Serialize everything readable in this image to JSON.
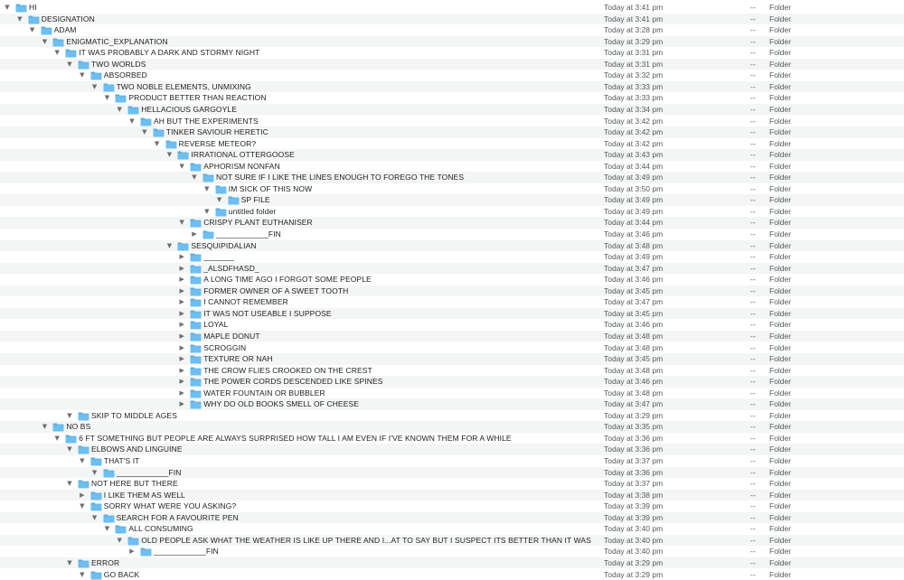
{
  "colors": {
    "folder_body": "#6cbff0",
    "folder_tab": "#5aaee2",
    "row_alt": "#f4f5f5"
  },
  "rows": [
    {
      "depth": 0,
      "disclosure": "open",
      "name": "HI",
      "date": "Today at 3:41 pm",
      "size": "--",
      "kind": "Folder"
    },
    {
      "depth": 1,
      "disclosure": "open",
      "name": "DESIGNATION",
      "date": "Today at 3:41 pm",
      "size": "--",
      "kind": "Folder"
    },
    {
      "depth": 2,
      "disclosure": "open",
      "name": "ADAM",
      "date": "Today at 3:28 pm",
      "size": "--",
      "kind": "Folder"
    },
    {
      "depth": 3,
      "disclosure": "open",
      "name": "ENIGMATIC_EXPLANATION",
      "date": "Today at 3:29 pm",
      "size": "--",
      "kind": "Folder"
    },
    {
      "depth": 4,
      "disclosure": "open",
      "name": "IT WAS PROBABLY A DARK AND STORMY NIGHT",
      "date": "Today at 3:31 pm",
      "size": "--",
      "kind": "Folder"
    },
    {
      "depth": 5,
      "disclosure": "open",
      "name": "TWO WORLDS",
      "date": "Today at 3:31 pm",
      "size": "--",
      "kind": "Folder"
    },
    {
      "depth": 6,
      "disclosure": "open",
      "name": "ABSORBED",
      "date": "Today at 3:32 pm",
      "size": "--",
      "kind": "Folder"
    },
    {
      "depth": 7,
      "disclosure": "open",
      "name": "TWO NOBLE ELEMENTS, UNMIXING",
      "date": "Today at 3:33 pm",
      "size": "--",
      "kind": "Folder"
    },
    {
      "depth": 8,
      "disclosure": "open",
      "name": "PRODUCT BETTER THAN REACTION",
      "date": "Today at 3:33 pm",
      "size": "--",
      "kind": "Folder"
    },
    {
      "depth": 9,
      "disclosure": "open",
      "name": "HELLACIOUS GARGOYLE",
      "date": "Today at 3:34 pm",
      "size": "--",
      "kind": "Folder"
    },
    {
      "depth": 10,
      "disclosure": "open",
      "name": "AH BUT THE EXPERIMENTS",
      "date": "Today at 3:42 pm",
      "size": "--",
      "kind": "Folder"
    },
    {
      "depth": 11,
      "disclosure": "open",
      "name": "TINKER SAVIOUR HERETIC",
      "date": "Today at 3:42 pm",
      "size": "--",
      "kind": "Folder"
    },
    {
      "depth": 12,
      "disclosure": "open",
      "name": "REVERSE METEOR?",
      "date": "Today at 3:42 pm",
      "size": "--",
      "kind": "Folder"
    },
    {
      "depth": 13,
      "disclosure": "open",
      "name": "IRRATIONAL OTTERGOOSE",
      "date": "Today at 3:43 pm",
      "size": "--",
      "kind": "Folder"
    },
    {
      "depth": 14,
      "disclosure": "open",
      "name": "APHORISM NONFAN",
      "date": "Today at 3:44 pm",
      "size": "--",
      "kind": "Folder"
    },
    {
      "depth": 15,
      "disclosure": "open",
      "name": "NOT SURE IF I LIKE THE LINES ENOUGH TO FOREGO THE TONES",
      "date": "Today at 3:49 pm",
      "size": "--",
      "kind": "Folder"
    },
    {
      "depth": 16,
      "disclosure": "open",
      "name": "IM SICK OF THIS NOW",
      "date": "Today at 3:50 pm",
      "size": "--",
      "kind": "Folder"
    },
    {
      "depth": 17,
      "disclosure": "open",
      "name": "SP FILE",
      "date": "Today at 3:49 pm",
      "size": "--",
      "kind": "Folder"
    },
    {
      "depth": 16,
      "disclosure": "open",
      "name": "untitled folder",
      "date": "Today at 3:49 pm",
      "size": "--",
      "kind": "Folder"
    },
    {
      "depth": 14,
      "disclosure": "open",
      "name": "CRISPY PLANT EUTHANISER",
      "date": "Today at 3:44 pm",
      "size": "--",
      "kind": "Folder"
    },
    {
      "depth": 15,
      "disclosure": "closed",
      "name": "____________FIN",
      "date": "Today at 3:46 pm",
      "size": "--",
      "kind": "Folder"
    },
    {
      "depth": 13,
      "disclosure": "open",
      "name": "SESQUIPIDALIAN",
      "date": "Today at 3:48 pm",
      "size": "--",
      "kind": "Folder"
    },
    {
      "depth": 14,
      "disclosure": "closed",
      "name": "_______",
      "date": "Today at 3:49 pm",
      "size": "--",
      "kind": "Folder"
    },
    {
      "depth": 14,
      "disclosure": "closed",
      "name": "_ALSDFHASD_",
      "date": "Today at 3:47 pm",
      "size": "--",
      "kind": "Folder"
    },
    {
      "depth": 14,
      "disclosure": "closed",
      "name": "A LONG TIME AGO I FORGOT SOME PEOPLE",
      "date": "Today at 3:46 pm",
      "size": "--",
      "kind": "Folder"
    },
    {
      "depth": 14,
      "disclosure": "closed",
      "name": "FORMER OWNER OF A SWEET TOOTH",
      "date": "Today at 3:45 pm",
      "size": "--",
      "kind": "Folder"
    },
    {
      "depth": 14,
      "disclosure": "closed",
      "name": "I CANNOT REMEMBER",
      "date": "Today at 3:47 pm",
      "size": "--",
      "kind": "Folder"
    },
    {
      "depth": 14,
      "disclosure": "closed",
      "name": "IT WAS NOT USEABLE I SUPPOSE",
      "date": "Today at 3:45 pm",
      "size": "--",
      "kind": "Folder"
    },
    {
      "depth": 14,
      "disclosure": "closed",
      "name": "LOYAL",
      "date": "Today at 3:46 pm",
      "size": "--",
      "kind": "Folder"
    },
    {
      "depth": 14,
      "disclosure": "closed",
      "name": "MAPLE DONUT",
      "date": "Today at 3:48 pm",
      "size": "--",
      "kind": "Folder"
    },
    {
      "depth": 14,
      "disclosure": "closed",
      "name": "SCROGGIN",
      "date": "Today at 3:48 pm",
      "size": "--",
      "kind": "Folder"
    },
    {
      "depth": 14,
      "disclosure": "closed",
      "name": "TEXTURE OR NAH",
      "date": "Today at 3:45 pm",
      "size": "--",
      "kind": "Folder"
    },
    {
      "depth": 14,
      "disclosure": "closed",
      "name": "THE CROW FLIES CROOKED ON THE CREST",
      "date": "Today at 3:48 pm",
      "size": "--",
      "kind": "Folder"
    },
    {
      "depth": 14,
      "disclosure": "closed",
      "name": "THE POWER CORDS DESCENDED LIKE SPINES",
      "date": "Today at 3:46 pm",
      "size": "--",
      "kind": "Folder"
    },
    {
      "depth": 14,
      "disclosure": "closed",
      "name": "WATER FOUNTAIN OR BUBBLER",
      "date": "Today at 3:48 pm",
      "size": "--",
      "kind": "Folder"
    },
    {
      "depth": 14,
      "disclosure": "closed",
      "name": "WHY DO OLD BOOKS SMELL OF CHEESE",
      "date": "Today at 3:47 pm",
      "size": "--",
      "kind": "Folder"
    },
    {
      "depth": 5,
      "disclosure": "open",
      "name": "SKIP TO MIDDLE AGES",
      "date": "Today at 3:29 pm",
      "size": "--",
      "kind": "Folder"
    },
    {
      "depth": 3,
      "disclosure": "open",
      "name": "NO BS",
      "date": "Today at 3:35 pm",
      "size": "--",
      "kind": "Folder"
    },
    {
      "depth": 4,
      "disclosure": "open",
      "name": "6 FT SOMETHING BUT PEOPLE ARE ALWAYS SURPRISED HOW TALL I AM EVEN IF I'VE KNOWN THEM FOR A WHILE",
      "date": "Today at 3:36 pm",
      "size": "--",
      "kind": "Folder"
    },
    {
      "depth": 5,
      "disclosure": "open",
      "name": "ELBOWS AND LINGUINE",
      "date": "Today at 3:36 pm",
      "size": "--",
      "kind": "Folder"
    },
    {
      "depth": 6,
      "disclosure": "open",
      "name": "THAT'S IT",
      "date": "Today at 3:37 pm",
      "size": "--",
      "kind": "Folder"
    },
    {
      "depth": 7,
      "disclosure": "open",
      "name": "____________FIN",
      "date": "Today at 3:36 pm",
      "size": "--",
      "kind": "Folder"
    },
    {
      "depth": 5,
      "disclosure": "open",
      "name": "NOT HERE BUT THERE",
      "date": "Today at 3:37 pm",
      "size": "--",
      "kind": "Folder"
    },
    {
      "depth": 6,
      "disclosure": "closed",
      "name": "I LIKE THEM AS WELL",
      "date": "Today at 3:38 pm",
      "size": "--",
      "kind": "Folder"
    },
    {
      "depth": 6,
      "disclosure": "open",
      "name": "SORRY WHAT WERE YOU ASKING?",
      "date": "Today at 3:39 pm",
      "size": "--",
      "kind": "Folder"
    },
    {
      "depth": 7,
      "disclosure": "open",
      "name": "SEARCH FOR A FAVOURITE PEN",
      "date": "Today at 3:39 pm",
      "size": "--",
      "kind": "Folder"
    },
    {
      "depth": 8,
      "disclosure": "open",
      "name": "ALL CONSUMING",
      "date": "Today at 3:40 pm",
      "size": "--",
      "kind": "Folder"
    },
    {
      "depth": 9,
      "disclosure": "open",
      "name": "OLD PEOPLE ASK WHAT THE WEATHER IS LIKE UP THERE AND I...AT TO SAY BUT I SUSPECT ITS BETTER THAN IT WAS IN THE WAR",
      "date": "Today at 3:40 pm",
      "size": "--",
      "kind": "Folder"
    },
    {
      "depth": 10,
      "disclosure": "closed",
      "name": "____________FIN",
      "date": "Today at 3:40 pm",
      "size": "--",
      "kind": "Folder"
    },
    {
      "depth": 5,
      "disclosure": "open",
      "name": "ERROR",
      "date": "Today at 3:29 pm",
      "size": "--",
      "kind": "Folder"
    },
    {
      "depth": 6,
      "disclosure": "open",
      "name": "GO BACK",
      "date": "Today at 3:29 pm",
      "size": "--",
      "kind": "Folder"
    }
  ]
}
